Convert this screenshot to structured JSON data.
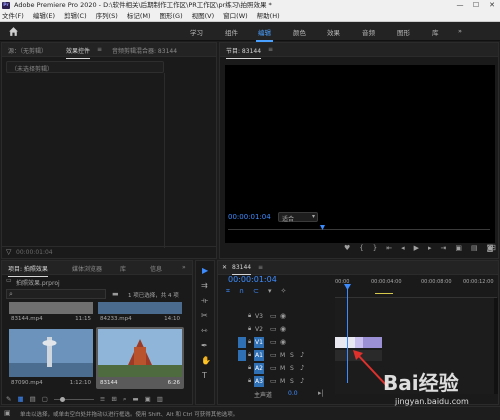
{
  "titlebar": {
    "logo": "Pr",
    "title": "Adobe Premiere Pro 2020 - D:\\软件相关\\后期制作工作区\\PR工作区\\pr练习\\拍照效果 *",
    "minimize": "—",
    "maximize": "☐",
    "close": "✕"
  },
  "menu": [
    "文件(F)",
    "编辑(E)",
    "剪辑(C)",
    "序列(S)",
    "标记(M)",
    "图形(G)",
    "视图(V)",
    "窗口(W)",
    "帮助(H)"
  ],
  "workspaces": {
    "tabs": [
      "学习",
      "组件",
      "编辑",
      "颜色",
      "效果",
      "音频",
      "图形",
      "库"
    ],
    "active": "编辑",
    "more": "»"
  },
  "source_panel": {
    "tabs": [
      "源：（无剪辑）",
      "效果控件",
      "音频剪辑混合器: 83144"
    ],
    "active_tab": "效果控件",
    "menu_glyph": "≡",
    "empty_text": "（未选择剪辑）",
    "timecode": "00:00:01:04"
  },
  "program_monitor": {
    "title": "节目: 83144",
    "menu_glyph": "≡",
    "timecode": "00:00:01:04",
    "fit": "适合",
    "icons": [
      "marker-icon",
      "in-point-icon",
      "out-point-icon",
      "go-to-in-icon",
      "step-back-icon",
      "play-icon",
      "step-forward-icon",
      "go-to-out-icon",
      "insert-icon",
      "overwrite-icon",
      "export-frame-icon"
    ]
  },
  "project_panel": {
    "tabs": [
      "项目: 拍照效果",
      "媒体浏览器",
      "库",
      "信息"
    ],
    "active_tab": "项目: 拍照效果",
    "more": "»",
    "file": "拍照效果.prproj",
    "selection_info": "1 项已选择，共 4 项",
    "items": [
      {
        "name": "83144.mp4",
        "duration": "11:15",
        "color": "#6f6f6f"
      },
      {
        "name": "84233.mp4",
        "duration": "14:10",
        "color": "#4a6a8e"
      },
      {
        "name": "87090.mp4",
        "duration": "1:12:10",
        "color": "#5d87b0"
      },
      {
        "name": "83144",
        "duration": "6:26",
        "color": "#8a6a52",
        "selected": true
      }
    ]
  },
  "tools": [
    "selection-tool-icon",
    "track-select-tool-icon",
    "ripple-edit-tool-icon",
    "razor-tool-icon",
    "slip-tool-icon",
    "pen-tool-icon",
    "hand-tool-icon",
    "type-tool-icon"
  ],
  "timeline": {
    "title": "83144",
    "menu_glyph": "≡",
    "timecode": "00:00:01:04",
    "ruler": [
      "00:00",
      "00:00:04:00",
      "00:00:08:00",
      "00:00:12:00"
    ],
    "video_tracks": [
      "V3",
      "V2",
      "V1"
    ],
    "audio_tracks": [
      "A1",
      "A2",
      "A3"
    ],
    "track_buttons": {
      "mute": "M",
      "solo": "S"
    },
    "master": "主声道",
    "master_value": "0.0",
    "clip_label": "83144"
  },
  "status_bar": "单击以选择，或单击空白处并拖动以进行框选。使用 Shift、Alt 和 Ctrl 可获得其他选项。",
  "watermark": {
    "text": "Bai经验",
    "url": "jingyan.baidu.com"
  },
  "colors": {
    "accent": "#3d8cff",
    "clip_video": "#9b8fd6",
    "arrow": "#e0302c"
  }
}
